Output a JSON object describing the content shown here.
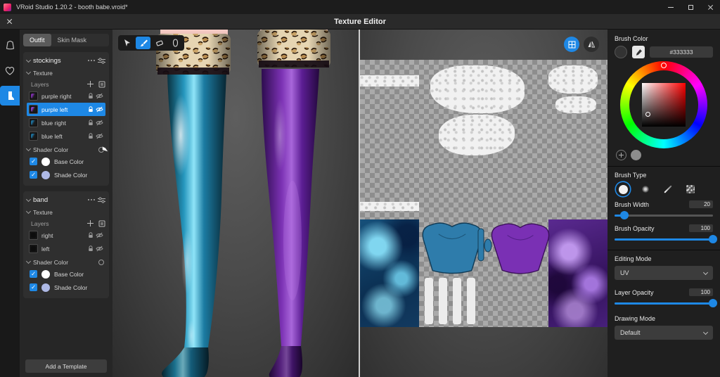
{
  "accent": "#1e88e5",
  "titlebar": {
    "title": "VRoid Studio 1.20.2 - booth babe.vroid*"
  },
  "header": {
    "title": "Texture Editor"
  },
  "left_panel": {
    "tabs": {
      "outfit": "Outfit",
      "skin_mask": "Skin Mask"
    },
    "sections": [
      {
        "title": "stockings",
        "texture_label": "Texture",
        "layers_label": "Layers",
        "layers": [
          {
            "name": "purple right",
            "selected": false
          },
          {
            "name": "purple left",
            "selected": true
          },
          {
            "name": "blue right",
            "selected": false
          },
          {
            "name": "blue left",
            "selected": false
          }
        ],
        "shader_label": "Shader Color",
        "shader_items": [
          {
            "label": "Base Color",
            "checked": true,
            "swatch": "#ffffff"
          },
          {
            "label": "Shade Color",
            "checked": true,
            "swatch": "#aeb9e6"
          }
        ]
      },
      {
        "title": "band",
        "texture_label": "Texture",
        "layers_label": "Layers",
        "layers": [
          {
            "name": "right",
            "selected": false
          },
          {
            "name": "left",
            "selected": false
          }
        ],
        "shader_label": "Shader Color",
        "shader_items": [
          {
            "label": "Base Color",
            "checked": true,
            "swatch": "#ffffff"
          },
          {
            "label": "Shade Color",
            "checked": true,
            "swatch": "#aeb9e6"
          }
        ]
      }
    ],
    "add_template_label": "Add a Template"
  },
  "right_panel": {
    "brush_color_label": "Brush Color",
    "hex_value": "#333333",
    "brush_type_label": "Brush Type",
    "brush_width_label": "Brush Width",
    "brush_width_value": "20",
    "brush_opacity_label": "Brush Opacity",
    "brush_opacity_value": "100",
    "editing_mode_label": "Editing Mode",
    "editing_mode_value": "UV",
    "layer_opacity_label": "Layer Opacity",
    "layer_opacity_value": "100",
    "drawing_mode_label": "Drawing Mode",
    "drawing_mode_value": "Default"
  }
}
